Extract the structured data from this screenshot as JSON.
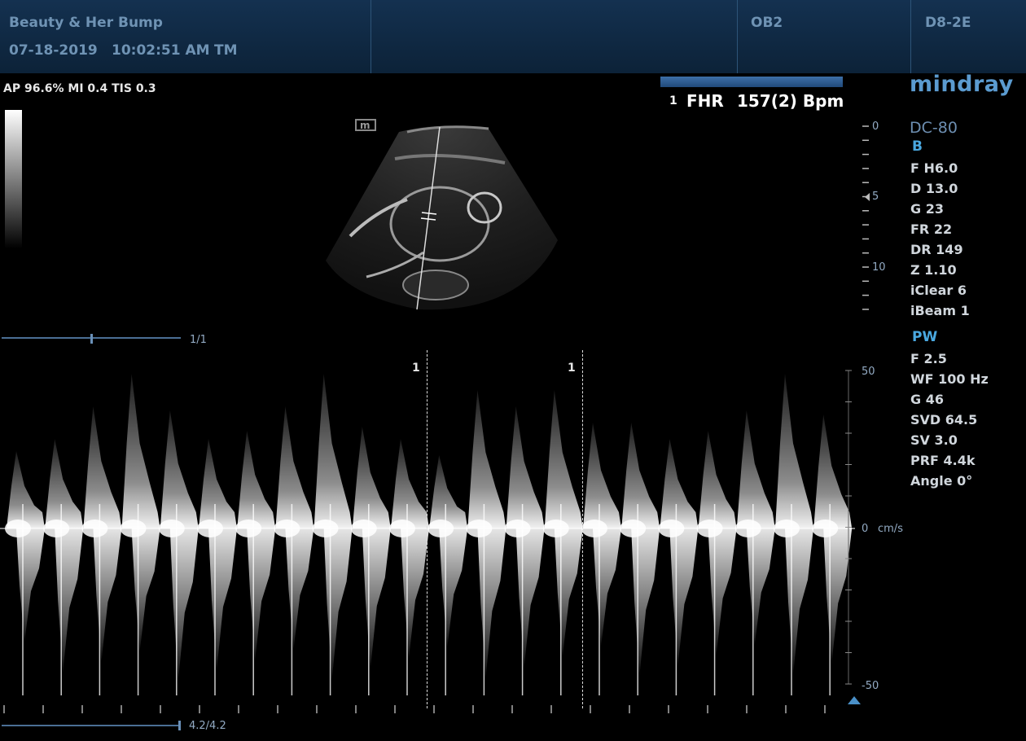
{
  "header": {
    "institution": "Beauty & Her Bump",
    "date": "07-18-2019",
    "time": "10:02:51 AM",
    "operator": "TM",
    "exam_preset": "OB2",
    "probe": "D8-2E"
  },
  "safety": {
    "text": "AP 96.6%  MI 0.4  TIS 0.3"
  },
  "brand": {
    "logo": "mindray",
    "model": "DC-80",
    "thumbnail_mark": "m"
  },
  "measurement": {
    "index": "1",
    "label": "FHR",
    "value": "157(2) Bpm"
  },
  "b_mode": {
    "title": "B",
    "params": [
      "F H6.0",
      "D 13.0",
      "G 23",
      "FR 22",
      "DR 149",
      "Z 1.10",
      "iClear 6",
      "iBeam 1"
    ],
    "depth_labels": [
      "0",
      "5",
      "10"
    ]
  },
  "pw_mode": {
    "title": "PW",
    "params": [
      "F 2.5",
      "WF 100 Hz",
      "G 46",
      "SVD 64.5",
      "SV 3.0",
      "PRF 4.4k",
      " Angle   0°"
    ],
    "velocity_labels": {
      "top": "50",
      "zero": "0",
      "unit": "cm/s",
      "bottom": "-50"
    }
  },
  "cine": {
    "b_frame": "1/1",
    "pw_time": "4.2/4.2"
  },
  "cycle_markers": [
    "1",
    "1"
  ],
  "colors": {
    "accent": "#4aa8e0",
    "header_text": "#6f93b4",
    "header_bg": "#102a45"
  }
}
